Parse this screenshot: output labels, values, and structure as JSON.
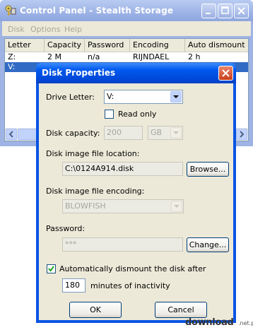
{
  "main_window": {
    "title": "Control Panel - Stealth Storage",
    "menu": [
      "Disk",
      "Options",
      "Help"
    ],
    "columns": [
      "Letter",
      "Capacity",
      "Password",
      "Encoding",
      "Auto dismount"
    ],
    "rows": [
      [
        "Z:",
        "2 M",
        "n/a",
        "RIJNDAEL",
        "2 h"
      ],
      [
        "V:",
        "",
        "",
        "",
        ""
      ]
    ]
  },
  "dialog": {
    "title": "Disk Properties",
    "drive_letter_label": "Drive Letter:",
    "drive_letter_value": "V:",
    "read_only_label": "Read only",
    "read_only_checked": false,
    "capacity_label": "Disk capacity:",
    "capacity_value": "200",
    "capacity_unit": "GB",
    "location_label": "Disk image file location:",
    "location_value": "C:\\0124A914.disk",
    "browse_label": "Browse...",
    "encoding_label": "Disk image file encoding:",
    "encoding_value": "BLOWFISH",
    "password_label": "Password:",
    "password_value": "***",
    "change_label": "Change...",
    "auto_dismount_label": "Automatically dismount the disk after",
    "auto_dismount_checked": true,
    "minutes_value": "180",
    "minutes_label": "minutes of inactivity",
    "ok_label": "OK",
    "cancel_label": "Cancel"
  },
  "watermark": {
    "text": "download",
    "tld": ".net.pl"
  },
  "colors": {
    "dialog_titlebar": "#0054e3",
    "inactive_titlebar": "#9db3e6",
    "dialog_face": "#ece9d8",
    "selection": "#316ac5",
    "close_button": "#c93f1b"
  }
}
